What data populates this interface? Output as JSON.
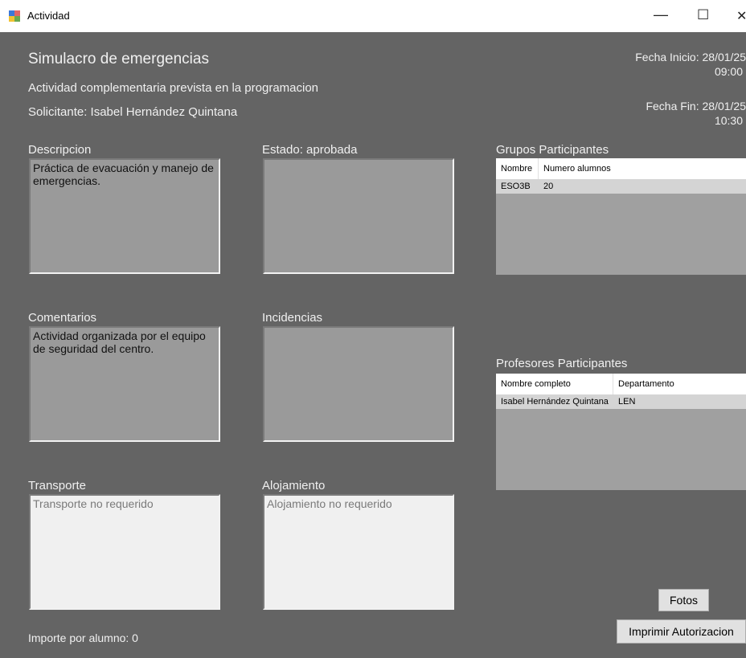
{
  "window": {
    "title": "Actividad",
    "controls": {
      "minimize": "—",
      "maximize": "☐",
      "close": "✕"
    }
  },
  "header": {
    "title": "Simulacro de emergencias",
    "subtitle": "Actividad complementaria prevista en la programacion",
    "solicitante": "Solicitante: Isabel Hernández Quintana",
    "fecha_inicio_line1": "Fecha Inicio: 28/01/25",
    "fecha_inicio_line2": "09:00",
    "fecha_fin_line1": "Fecha Fin: 28/01/25",
    "fecha_fin_line2": "10:30"
  },
  "descripcion": {
    "label": "Descripcion",
    "value": "Práctica de evacuación y manejo de emergencias."
  },
  "estado": {
    "label": "Estado: aprobada",
    "value": ""
  },
  "comentarios": {
    "label": "Comentarios",
    "value": "Actividad organizada por el equipo de seguridad del centro."
  },
  "incidencias": {
    "label": "Incidencias",
    "value": ""
  },
  "transporte": {
    "label": "Transporte",
    "value": "Transporte no requerido"
  },
  "alojamiento": {
    "label": "Alojamiento",
    "value": "Alojamiento no requerido"
  },
  "importe": "Importe por alumno: 0",
  "grupos": {
    "label": "Grupos Participantes",
    "columns": [
      "Nombre",
      "Numero alumnos"
    ],
    "rows": [
      [
        "ESO3B",
        "20"
      ]
    ]
  },
  "profesores": {
    "label": "Profesores Participantes",
    "columns": [
      "Nombre completo",
      "Departamento"
    ],
    "rows": [
      [
        "Isabel Hernández Quintana",
        "LEN"
      ]
    ]
  },
  "buttons": {
    "fotos": "Fotos",
    "imprimir": "Imprimir Autorizacion"
  }
}
